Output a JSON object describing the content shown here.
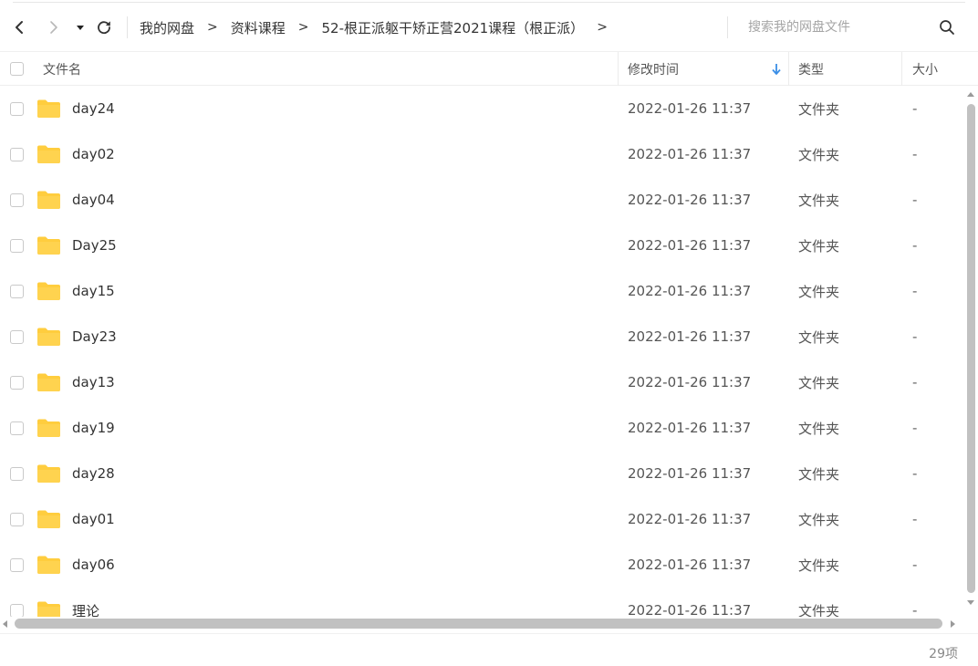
{
  "breadcrumb": {
    "items": [
      "我的网盘",
      "资料课程",
      "52-根正派躯干矫正营2021课程（根正派）"
    ],
    "separator": ">"
  },
  "search": {
    "placeholder": "搜索我的网盘文件"
  },
  "columns": {
    "name": "文件名",
    "modified": "修改时间",
    "type": "类型",
    "size": "大小"
  },
  "sort": {
    "column": "modified",
    "direction": "desc"
  },
  "files": [
    {
      "name": "day24",
      "modified": "2022-01-26 11:37",
      "type": "文件夹",
      "size": "-"
    },
    {
      "name": "day02",
      "modified": "2022-01-26 11:37",
      "type": "文件夹",
      "size": "-"
    },
    {
      "name": "day04",
      "modified": "2022-01-26 11:37",
      "type": "文件夹",
      "size": "-"
    },
    {
      "name": "Day25",
      "modified": "2022-01-26 11:37",
      "type": "文件夹",
      "size": "-"
    },
    {
      "name": "day15",
      "modified": "2022-01-26 11:37",
      "type": "文件夹",
      "size": "-"
    },
    {
      "name": "Day23",
      "modified": "2022-01-26 11:37",
      "type": "文件夹",
      "size": "-"
    },
    {
      "name": "day13",
      "modified": "2022-01-26 11:37",
      "type": "文件夹",
      "size": "-"
    },
    {
      "name": "day19",
      "modified": "2022-01-26 11:37",
      "type": "文件夹",
      "size": "-"
    },
    {
      "name": "day28",
      "modified": "2022-01-26 11:37",
      "type": "文件夹",
      "size": "-"
    },
    {
      "name": "day01",
      "modified": "2022-01-26 11:37",
      "type": "文件夹",
      "size": "-"
    },
    {
      "name": "day06",
      "modified": "2022-01-26 11:37",
      "type": "文件夹",
      "size": "-"
    },
    {
      "name": "理论",
      "modified": "2022-01-26 11:37",
      "type": "文件夹",
      "size": "-"
    }
  ],
  "footer": {
    "count": "29项"
  },
  "colors": {
    "folder": "#FFCD3E",
    "sort_arrow": "#3a8ee6"
  }
}
